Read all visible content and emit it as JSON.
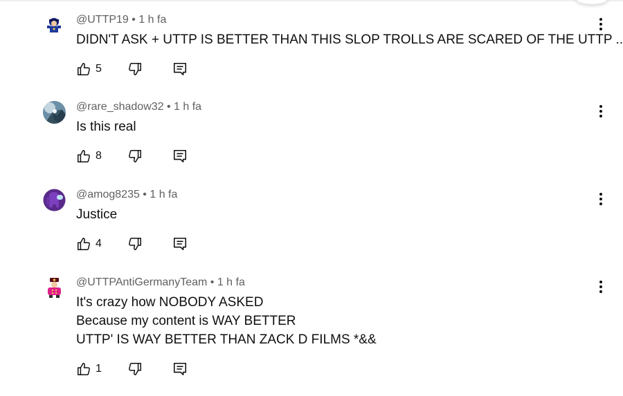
{
  "comments": [
    {
      "author": "@UTTP19",
      "time": "1 h fa",
      "lines": [
        "DIDN'T ASK + UTTP IS BETTER THAN THIS SLOP TROLLS ARE SCARED OF THE UTTP ..,..,"
      ],
      "likes": "5"
    },
    {
      "author": "@rare_shadow32",
      "time": "1 h fa",
      "lines": [
        "Is this real"
      ],
      "likes": "8"
    },
    {
      "author": "@amog8235",
      "time": "1 h fa",
      "lines": [
        "Justice"
      ],
      "likes": "4"
    },
    {
      "author": "@UTTPAntiGermanyTeam",
      "time": "1 h fa",
      "lines": [
        "It's crazy how NOBODY ASKED",
        "Because my content is WAY BETTER",
        "UTTP' IS WAY BETTER THAN ZACK D FILMS *&&"
      ],
      "likes": "1"
    }
  ],
  "separator": " • ",
  "icons": {
    "like": "thumbs-up-icon",
    "dislike": "thumbs-down-icon",
    "reply": "reply-comment-icon",
    "more": "more-vertical-icon"
  },
  "colors": {
    "text": "#0f0f0f",
    "meta": "#606060",
    "background": "#ffffff"
  }
}
